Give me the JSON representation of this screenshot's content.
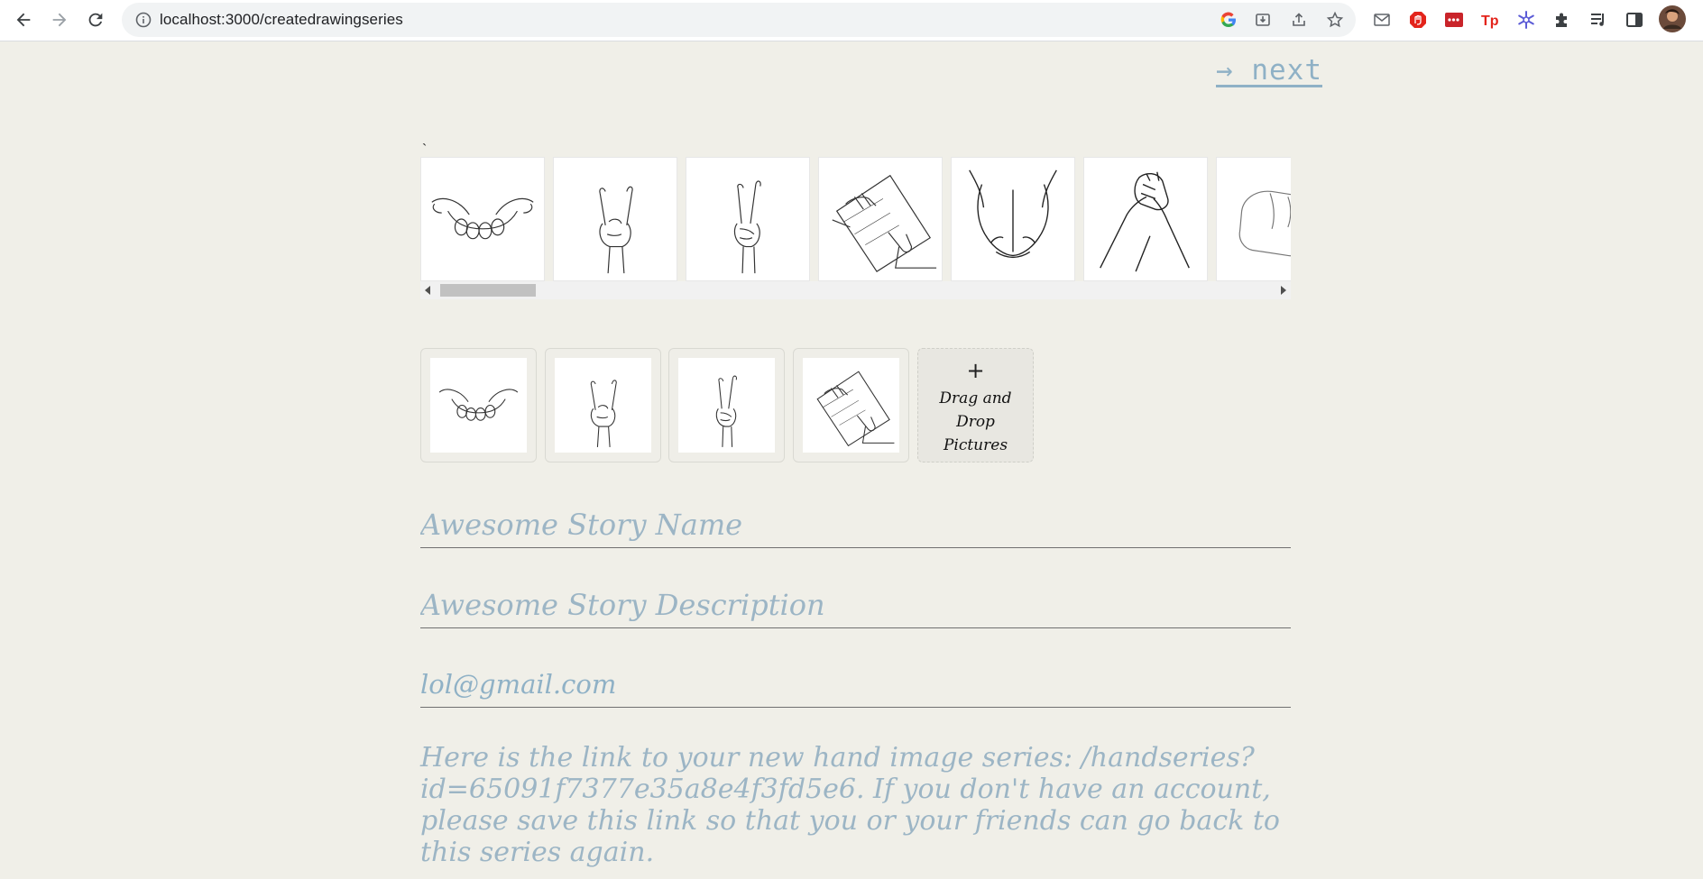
{
  "browser": {
    "url": "localhost:3000/createdrawingseries",
    "icons": {
      "back": "back-arrow-icon",
      "forward": "forward-arrow-icon",
      "reload": "reload-icon",
      "info": "info-icon",
      "google": "google-icon",
      "install": "install-app-icon",
      "share": "share-icon",
      "bookmark": "star-icon"
    },
    "extensions": [
      "mail-icon",
      "adblock-icon",
      "lastpass-icon",
      "teleparty-icon",
      "snowflake-icon",
      "puzzle-extensions-icon",
      "media-control-icon",
      "side-panel-icon",
      "profile-avatar"
    ]
  },
  "page": {
    "next_label": "→ next",
    "stray_mark": "`",
    "carousel": {
      "images": [
        "open-cupped-hands",
        "rock-sign-hand",
        "peace-sign-hand",
        "hands-writing-on-paper",
        "cupped-hands-pair",
        "clasped-wrists",
        "fist-hand"
      ]
    },
    "selected": {
      "images": [
        "open-cupped-hands",
        "rock-sign-hand",
        "peace-sign-hand",
        "hands-writing-on-paper"
      ],
      "dropzone_plus": "+",
      "dropzone_label": "Drag and Drop Pictures"
    },
    "form": {
      "name_placeholder": "Awesome Story Name",
      "description_placeholder": "Awesome Story Description",
      "email_value": "lol@gmail.com"
    },
    "info_text": "Here is the link to your new hand image series: /handseries?id=65091f7377e35a8e4f3fd5e6. If you don't have an account, please save this link so that you or your friends can go back to this series again.",
    "colors": {
      "background": "#f0efe8",
      "accent_text": "#8fb1c6",
      "field_underline": "#707070"
    }
  }
}
